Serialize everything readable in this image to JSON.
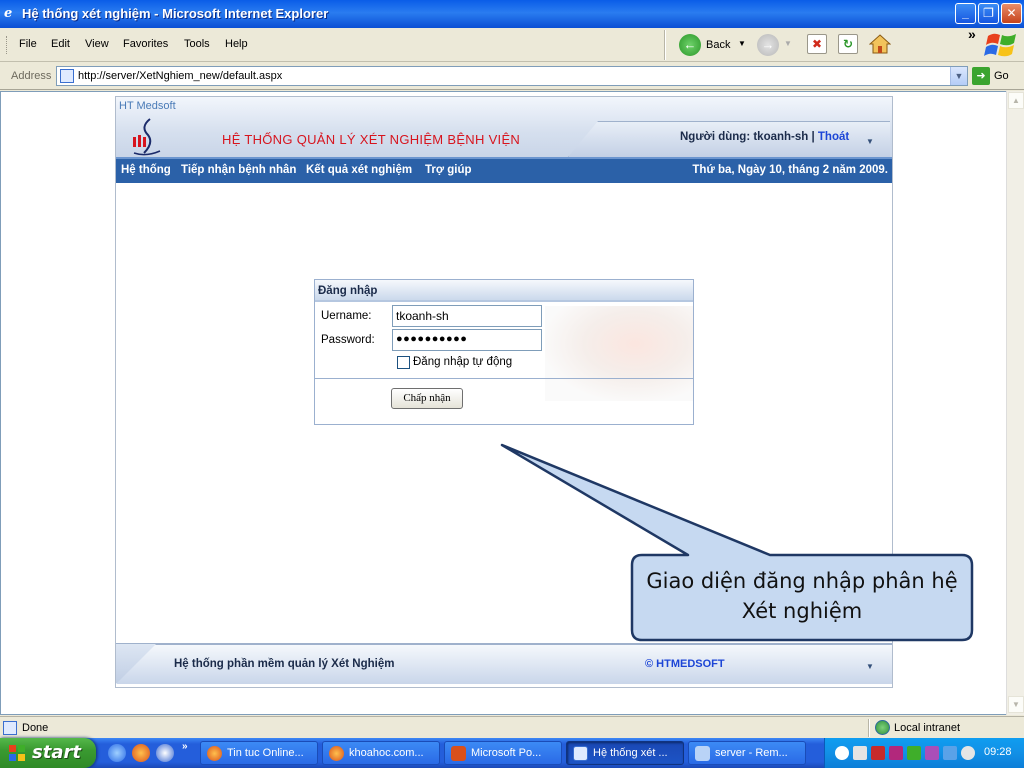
{
  "window": {
    "title": "Hệ thống xét nghiệm - Microsoft Internet Explorer"
  },
  "menu": [
    "File",
    "Edit",
    "View",
    "Favorites",
    "Tools",
    "Help"
  ],
  "toolbar": {
    "back_label": "Back",
    "chevron": "»"
  },
  "address": {
    "label": "Address",
    "url": "http://server/XetNghiem_new/default.aspx",
    "go_label": "Go"
  },
  "site": {
    "brand": "HT Medsoft",
    "title": "HỆ THỐNG QUẢN LÝ XÉT NGHIỆM BỆNH VIỆN",
    "user_label": "Người dùng: tkoanh-sh | ",
    "logout": "Thoát",
    "nav": [
      "Hệ thống",
      "Tiếp nhận bệnh nhân",
      "Kết quả xét nghiệm",
      "Trợ giúp"
    ],
    "date": "Thứ ba, Ngày 10, tháng 2 năm 2009.",
    "footer_text": "Hệ thống phần mềm quản lý Xét Nghiệm",
    "footer_copy": "© HTMEDSOFT"
  },
  "login": {
    "title": "Đăng nhập",
    "username_label": "Uername:",
    "username_value": "tkoanh-sh",
    "password_label": "Password:",
    "password_value": "●●●●●●●●●●",
    "auto_login": "Đăng nhập tự động",
    "submit": "Chấp nhận"
  },
  "callout": {
    "text": "Giao diện đăng nhập phân hệ Xét nghiệm"
  },
  "status": {
    "text": "Done",
    "zone": "Local intranet"
  },
  "taskbar": {
    "start": "start",
    "tasks": [
      "Tin tuc Online...",
      "khoahoc.com...",
      "Microsoft Po...",
      "Hệ thống xét ...",
      "server - Rem..."
    ],
    "clock": "09:28"
  }
}
